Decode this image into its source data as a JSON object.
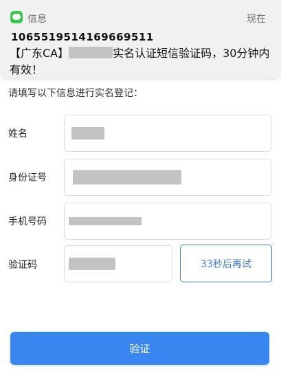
{
  "notification": {
    "app_name": "信息",
    "time": "现在",
    "sender": "1065519514169669511",
    "message_prefix": "【广东CA】",
    "message_suffix": "实名认证短信验证码，30分钟内有效！"
  },
  "form": {
    "instruction": "请填写以下信息进行实名登记：",
    "name_label": "姓名",
    "id_label": "身份证号",
    "phone_label": "手机号码",
    "code_label": "验证码",
    "retry_button": "33秒后再试",
    "verify_button": "验证"
  },
  "colors": {
    "accent": "#3a86f0",
    "retry_border": "#3d7fd6",
    "redaction": "#c3c3c3",
    "messages_icon": "#35c84b"
  }
}
